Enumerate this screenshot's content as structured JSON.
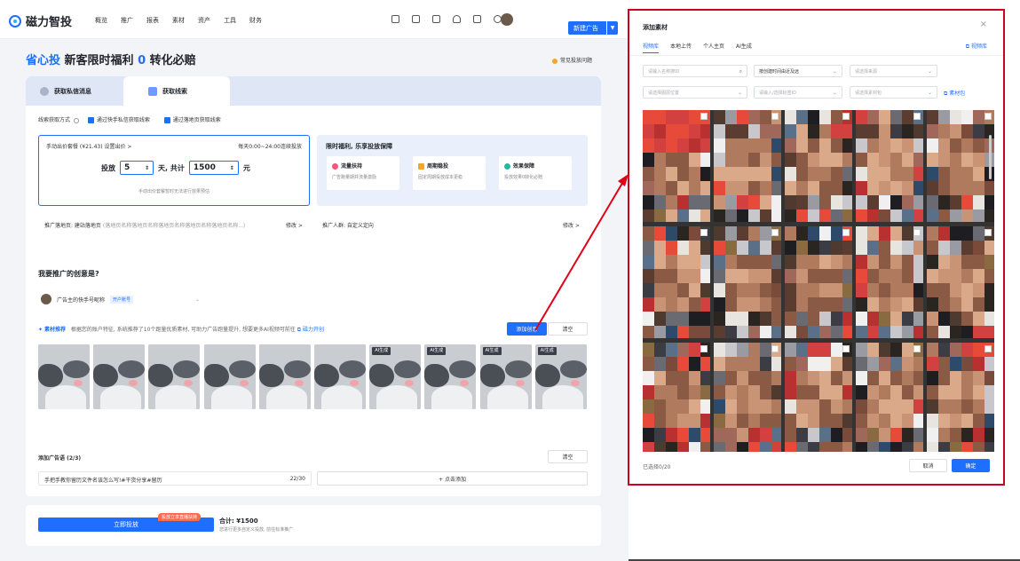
{
  "app": {
    "logo_text": "磁力智投",
    "nav": [
      "概览",
      "推广",
      "报表",
      "素材",
      "资产",
      "工具",
      "财务"
    ],
    "new_ad_label": "新建广告"
  },
  "banner": {
    "part1": "省心投",
    "part2": "新客限时福利",
    "num": "0",
    "part3": "转化必赔",
    "faq": "常见投放问题"
  },
  "tabs": [
    "获取私信消息",
    "获取线索"
  ],
  "lead_method": {
    "label": "线索获取方式",
    "opt1": "通过快手私信获取线索",
    "opt2": "通过落地页获取线索"
  },
  "bid": {
    "header_left": "手动出价套餐 (¥21.43) 设置出价 >",
    "header_right": "每天0:00~24:00连续投放",
    "label_put": "投放",
    "days": "5",
    "unit_days": "天, 共计",
    "amount": "1500",
    "unit_yuan": "元",
    "note": "手动出价套餐暂时无法进行效果预估"
  },
  "benefit": {
    "title": "限时福利, 乐享投放保障",
    "items": [
      {
        "title": "流量扶持",
        "desc": "广告跑量期并流量激励",
        "color": "#f5567a"
      },
      {
        "title": "周期稳投",
        "desc": "固定周期投放成本更稳",
        "color": "#f5a623"
      },
      {
        "title": "效果保障",
        "desc": "投放效果0转化必赔",
        "color": "#2db5a4"
      }
    ]
  },
  "landing": {
    "label": "推广落地页: 建站落地页",
    "value": "(落地页名称落地页名称落地页名称落地页名称落地页名称...)",
    "modify": "修改 >",
    "audience": "推广人群: 自定义定向",
    "modify2": "修改 >"
  },
  "creative": {
    "title": "我要推广的创意是?",
    "account": "广告主的快手号昵称",
    "account_tag": "开户账号",
    "rec_label": "素材推荐",
    "rec_text": "根据您的账户特征, 系统推荐了10个跑量优质素材, 可助力广告跑量提升, 想要更多AI视频可前往",
    "rec_link": "磁力开创",
    "add_btn": "添加创意",
    "clear_btn": "清空",
    "ai_tag": "AI生成",
    "thumbs_ai": [
      false,
      false,
      false,
      false,
      false,
      false,
      true,
      true,
      true,
      true
    ]
  },
  "adtext": {
    "label": "添加广告语 (2/3)",
    "clear": "清空",
    "text1": "手把手教你留历文件名该怎么写!#干货分享#留历",
    "count1": "22/30",
    "add": "+ 点击添加"
  },
  "footer": {
    "submit": "立即投放",
    "promo_tag": "投放立享直播扶持",
    "total": "合计: ¥1500",
    "note": "您进行更多自定义投放, 前往标准推广"
  },
  "panel": {
    "title": "添加素材",
    "tabs": [
      "视频库",
      "本地上传",
      "个人主页",
      "AI生成"
    ],
    "link": "视频库",
    "search_placeholder": "请输入名称搜ID",
    "sort": "按创建时间由近及远",
    "filter1": "请选择来源",
    "filter2": "请选择图层位置",
    "filter3": "请输入/选择标签ID",
    "filter4": "请选择素材包",
    "pkg_link": "素材包",
    "selected": "已选择0/20",
    "cancel": "取消",
    "confirm": "确定"
  }
}
